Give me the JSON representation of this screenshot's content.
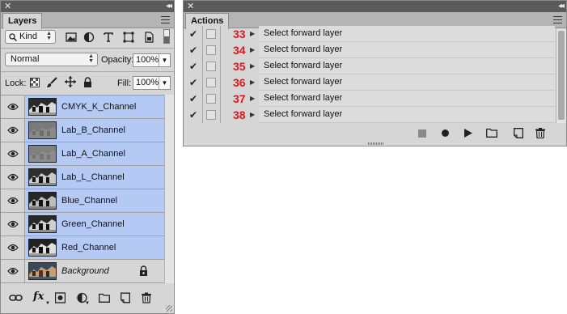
{
  "layers_panel": {
    "tab": "Layers",
    "filter": {
      "label": "Kind"
    },
    "blend_mode": "Normal",
    "opacity": {
      "label": "Opacity:",
      "value": "100%"
    },
    "lock_label": "Lock:",
    "fill": {
      "label": "Fill:",
      "value": "100%"
    },
    "layers": [
      {
        "name": "CMYK_K_Channel",
        "selected": true,
        "italic": false,
        "locked": false
      },
      {
        "name": "Lab_B_Channel",
        "selected": true,
        "italic": false,
        "locked": false
      },
      {
        "name": "Lab_A_Channel",
        "selected": true,
        "italic": false,
        "locked": false
      },
      {
        "name": "Lab_L_Channel",
        "selected": true,
        "italic": false,
        "locked": false
      },
      {
        "name": "Blue_Channel",
        "selected": true,
        "italic": false,
        "locked": false
      },
      {
        "name": "Green_Channel",
        "selected": true,
        "italic": false,
        "locked": false
      },
      {
        "name": "Red_Channel",
        "selected": true,
        "italic": false,
        "locked": false
      },
      {
        "name": "Background",
        "selected": false,
        "italic": true,
        "locked": true
      }
    ],
    "footer_fx": "fx"
  },
  "actions_panel": {
    "tab": "Actions",
    "actions": [
      {
        "number": "33",
        "name": "Select forward layer"
      },
      {
        "number": "34",
        "name": "Select forward layer"
      },
      {
        "number": "35",
        "name": "Select forward layer"
      },
      {
        "number": "36",
        "name": "Select forward layer"
      },
      {
        "number": "37",
        "name": "Select forward layer"
      },
      {
        "number": "38",
        "name": "Select forward layer"
      }
    ]
  },
  "colors": {
    "panel_bg": "#d6d6d6",
    "selection": "#b5c9f5",
    "action_number": "#e0181d",
    "titlebar": "#5a5a5a"
  }
}
